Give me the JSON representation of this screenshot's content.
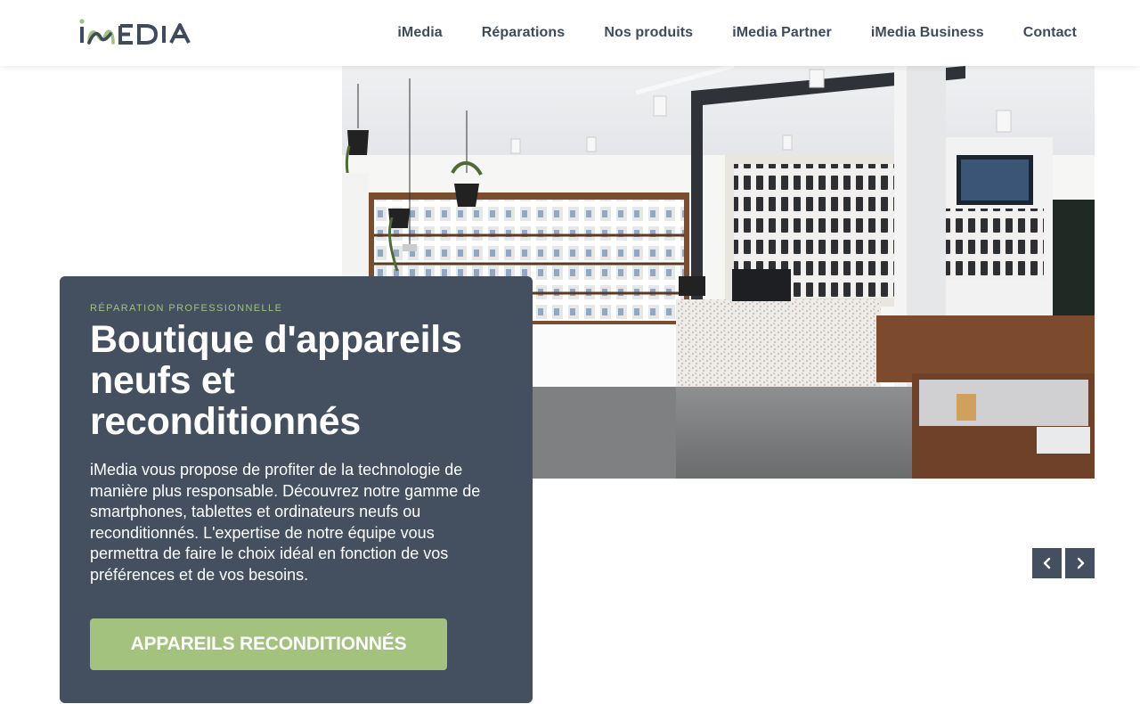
{
  "header": {
    "logo_text": "iMEDIA",
    "nav": [
      {
        "label": "iMedia"
      },
      {
        "label": "Réparations"
      },
      {
        "label": "Nos produits"
      },
      {
        "label": "iMedia Partner"
      },
      {
        "label": "iMedia Business"
      },
      {
        "label": "Contact"
      }
    ]
  },
  "hero": {
    "eyebrow": "Réparation professionnelle",
    "title": "Boutique d'appareils neufs et reconditionnés",
    "description": "iMedia vous propose de profiter de la technologie de manière plus responsable. Découvrez notre gamme de smartphones, tablettes et ordinateurs neufs ou reconditionnés. L'expertise de notre équipe vous permettra de faire le choix idéal en fonction de vos préférences et de vos besoins.",
    "cta_label": "APPAREILS RECONDITIONNÉS"
  },
  "slider": {
    "prev_icon": "chevron-left-icon",
    "next_icon": "chevron-right-icon"
  },
  "colors": {
    "primary_dark": "#44505f",
    "accent_green": "#a3c27e",
    "eyebrow_green": "#9fc27f",
    "nav_text": "#3f4a5c"
  }
}
